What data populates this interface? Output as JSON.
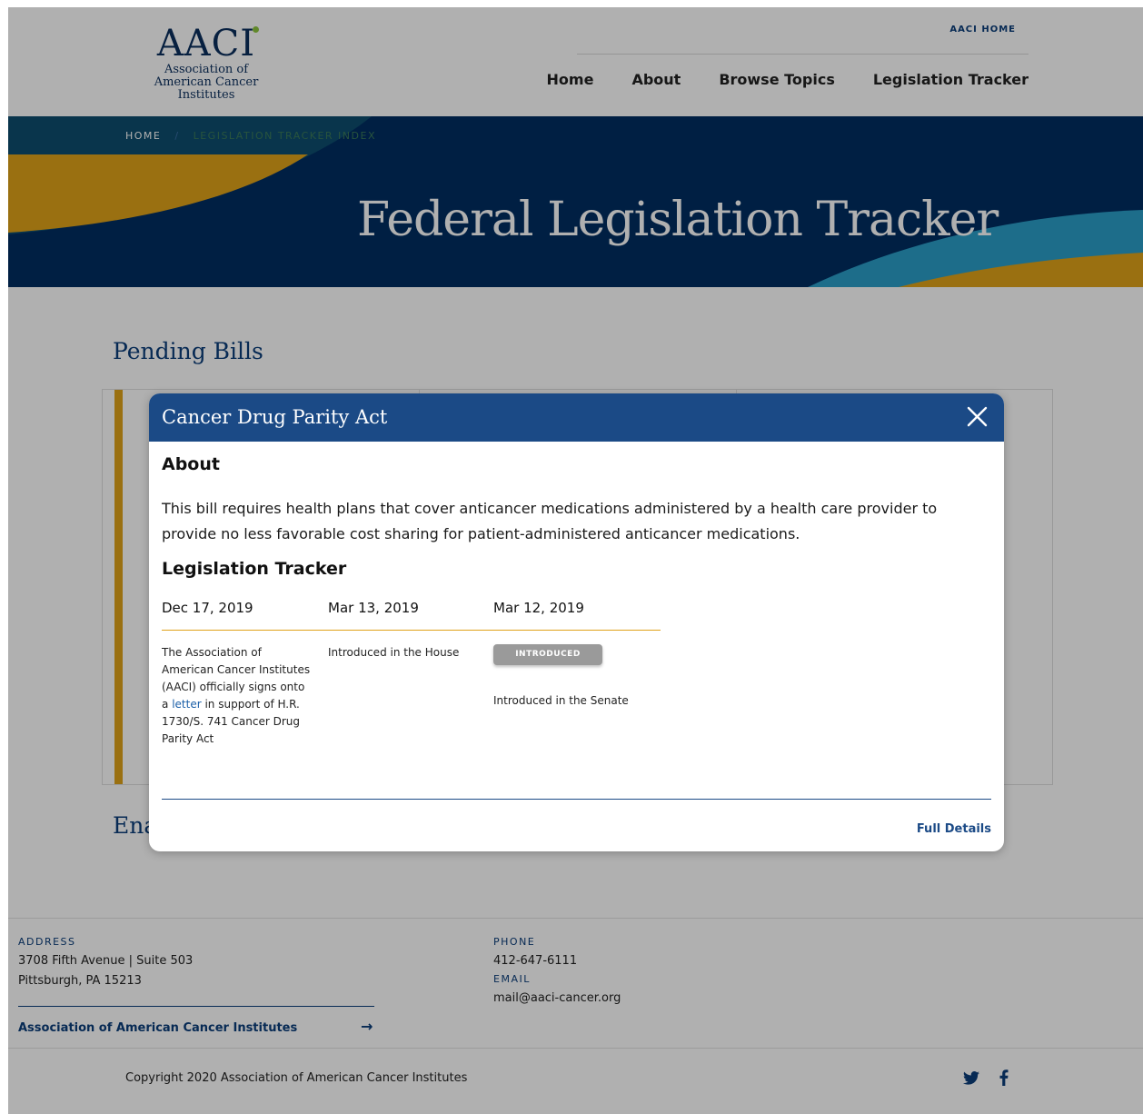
{
  "header": {
    "logo": {
      "mark": "AACI",
      "line1": "Association of",
      "line2": "American Cancer Institutes"
    },
    "top_link": "AACI HOME",
    "nav": [
      "Home",
      "About",
      "Browse Topics",
      "Legislation Tracker"
    ]
  },
  "hero": {
    "breadcrumb": {
      "home": "HOME",
      "separator": "/",
      "current": "LEGISLATION TRACKER INDEX"
    },
    "title": "Federal Legislation Tracker"
  },
  "main": {
    "pending_heading": "Pending Bills",
    "enacted_heading_visible": "Ena"
  },
  "modal": {
    "title": "Cancer Drug Parity Act",
    "about_heading": "About",
    "about_text": "This bill requires health plans that cover anticancer medications administered by a health care provider to provide no less favorable cost sharing for patient-administered anticancer medications.",
    "tracker_heading": "Legislation Tracker",
    "tracker": [
      {
        "date": "Dec 17, 2019",
        "desc_before": "The Association of American Cancer Institutes (AACI) officially signs onto a",
        "link": "letter",
        "desc_after": "in support of H.R. 1730/S. 741 Cancer Drug Parity Act"
      },
      {
        "date": "Mar 13, 2019",
        "desc": "Introduced in the House"
      },
      {
        "date": "Mar 12, 2019",
        "status": "INTRODUCED",
        "desc": "Introduced in the Senate"
      }
    ],
    "full_details": "Full Details"
  },
  "footer": {
    "address_label": "ADDRESS",
    "address_line1": "3708 Fifth Avenue | Suite 503",
    "address_line2": "Pittsburgh, PA 15213",
    "phone_label": "PHONE",
    "phone": "412-647-6111",
    "email_label": "EMAIL",
    "email": "mail@aaci-cancer.org",
    "org_link": "Association of American Cancer Institutes",
    "arrow": "→",
    "copyright": "Copyright 2020 Association of American Cancer Institutes"
  },
  "colors": {
    "navy": "#002d62",
    "blue": "#1b4a86",
    "gold": "#e0a21a",
    "teal": "#2a9fc9"
  }
}
